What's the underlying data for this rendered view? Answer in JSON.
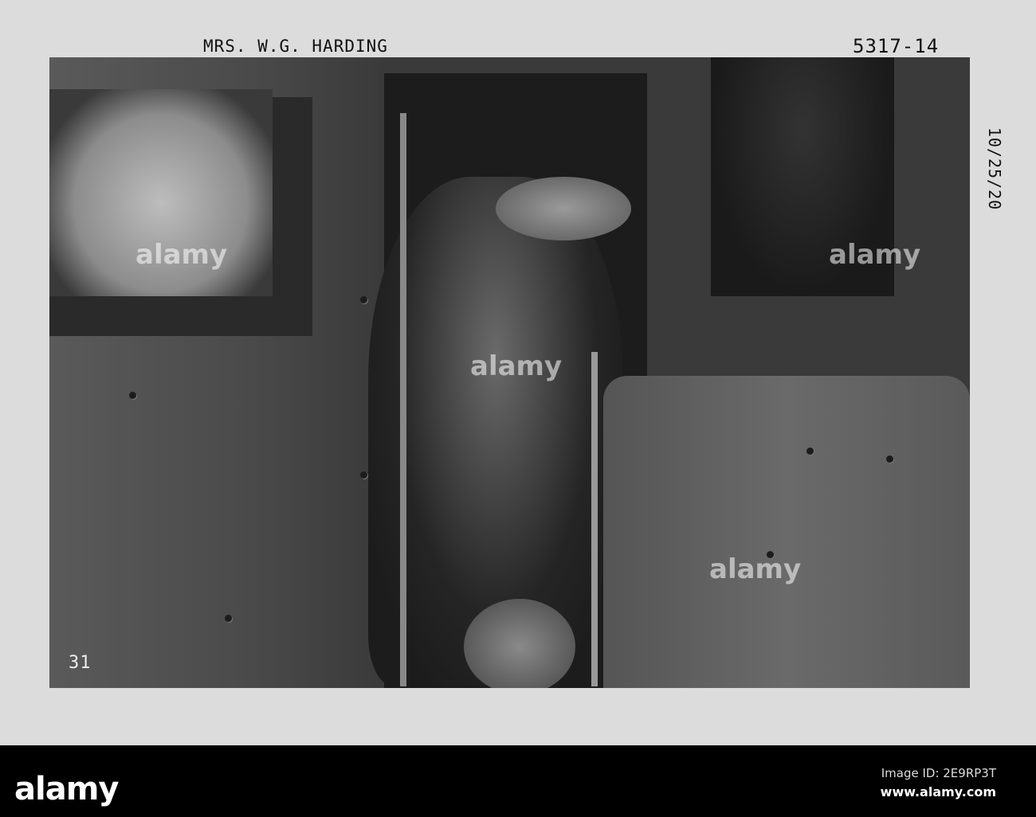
{
  "photo": {
    "caption": "MRS. W.G. HARDING",
    "negative_number": "5317-14",
    "date_note": "10/25/20",
    "car_number": "31",
    "watermark": "alamy"
  },
  "footer": {
    "logo": "alamy",
    "image_id": "Image ID: 2E9RP3T",
    "website": "www.alamy.com"
  }
}
